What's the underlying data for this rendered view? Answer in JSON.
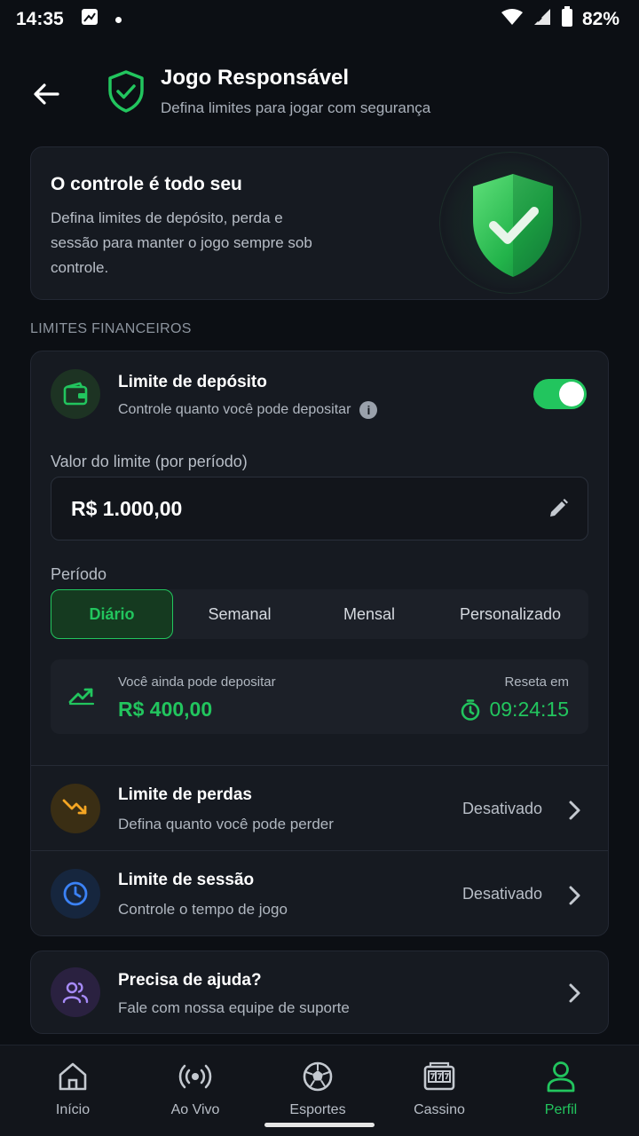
{
  "status_bar": {
    "time": "14:35",
    "battery": "82%"
  },
  "header": {
    "title": "Jogo Responsável",
    "subtitle": "Defina limites para jogar com segurança"
  },
  "hero": {
    "title": "O controle é todo seu",
    "text": "Defina limites de depósito, perda e sessão para manter o jogo sempre sob controle."
  },
  "section_label": "LIMITES FINANCEIROS",
  "deposit": {
    "title": "Limite de depósito",
    "subtitle": "Controle quanto você pode depositar",
    "enabled": true,
    "field_label": "Valor do limite (por período)",
    "amount": "R$ 1.000,00",
    "period_label": "Período",
    "periods": [
      "Diário",
      "Semanal",
      "Mensal",
      "Personalizado"
    ],
    "selected_period": "Diário",
    "remaining_label": "Você ainda pode depositar",
    "remaining_value": "R$ 400,00",
    "reset_label": "Reseta em",
    "reset_value": "09:24:15"
  },
  "loss_limit": {
    "title": "Limite de perdas",
    "subtitle": "Defina quanto você pode perder",
    "status": "Desativado"
  },
  "session_limit": {
    "title": "Limite de sessão",
    "subtitle": "Controle o tempo de jogo",
    "status": "Desativado"
  },
  "help": {
    "title": "Precisa de ajuda?",
    "subtitle": "Fale com nossa equipe de suporte"
  },
  "nav": {
    "items": [
      {
        "label": "Início",
        "icon": "home-icon"
      },
      {
        "label": "Ao Vivo",
        "icon": "live-icon"
      },
      {
        "label": "Esportes",
        "icon": "soccer-ball-icon"
      },
      {
        "label": "Cassino",
        "icon": "slot-machine-icon"
      },
      {
        "label": "Perfil",
        "icon": "user-icon"
      }
    ],
    "active": "Perfil"
  },
  "colors": {
    "accent": "#22c55e",
    "background": "#0c0f14",
    "card": "#161a21",
    "loss_icon": "#f5a623",
    "session_icon": "#3b82f6",
    "help_icon": "#a78bfa"
  }
}
